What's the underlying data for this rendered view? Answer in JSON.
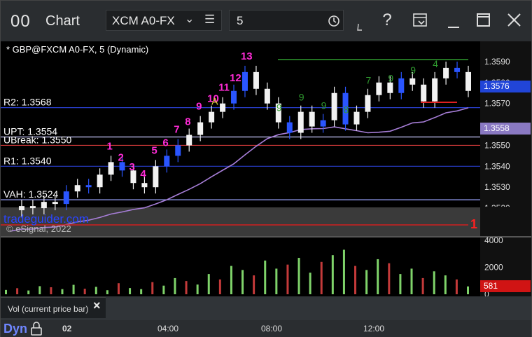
{
  "window": {
    "logo": "00",
    "title": "Chart",
    "symbol": "XCM A0-FX",
    "interval": "5",
    "menu_icon": "hamburger-icon",
    "help": "?"
  },
  "chart": {
    "title": "* GBP@FXCM A0-FX, 5 (Dynamic)",
    "copyright": "© eSignal, 2022",
    "watermark": "tradeguider.com",
    "price_axis": [
      "1.3590",
      "1.3580",
      "1.3570",
      "1.3550",
      "1.3540",
      "1.3530",
      "1.3520"
    ],
    "last_price": "1.3576",
    "ma_price": "1.3558",
    "red_marker": "1",
    "levels": [
      {
        "label": "R2: 1.3568",
        "price": 1.3568,
        "color": "#2a3fd0"
      },
      {
        "label": "UPT: 1.3554",
        "price": 1.3554,
        "color": "#c9c9ff"
      },
      {
        "label": "UBreak: 1.3550",
        "price": 1.355,
        "color": "#d23a3a"
      },
      {
        "label": "R1: 1.3540",
        "price": 1.354,
        "color": "#2a3fd0"
      },
      {
        "label": "VAH: 1.3524",
        "price": 1.3524,
        "color": "#9aa6ff"
      }
    ],
    "magenta_counts": [
      "13",
      "12",
      "11",
      "10",
      "9",
      "8",
      "7",
      "6",
      "5",
      "4",
      "3",
      "2",
      "1"
    ],
    "green_counts": [
      "9",
      "9",
      "9",
      "8",
      "7",
      "9",
      "9",
      "4"
    ],
    "marker_a": "A"
  },
  "volume": {
    "label": "Vol (current price bar)",
    "axis": [
      "4000",
      "2000",
      "0"
    ],
    "current": "581",
    "close_icon": "×"
  },
  "footer": {
    "mode": "Dyn",
    "times": [
      "02",
      "04:00",
      "08:00",
      "12:00"
    ]
  },
  "chart_data": {
    "type": "candlestick",
    "x": [
      "02",
      "04:00",
      "08:00",
      "12:00"
    ],
    "ylim": [
      1.3512,
      1.3597
    ],
    "price_series": [
      1.3519,
      1.3521,
      1.352,
      1.3523,
      1.3522,
      1.3528,
      1.3531,
      1.353,
      1.3536,
      1.3542,
      1.3538,
      1.3532,
      1.353,
      1.354,
      1.3545,
      1.355,
      1.3555,
      1.3561,
      1.3566,
      1.357,
      1.3576,
      1.3585,
      1.3577,
      1.357,
      1.3561,
      1.3556,
      1.3566,
      1.3559,
      1.3562,
      1.3575,
      1.356,
      1.3566,
      1.3574,
      1.358,
      1.3575,
      1.3582,
      1.3579,
      1.3571,
      1.3582,
      1.3587,
      1.3585,
      1.3576
    ],
    "volume_ylim": [
      0,
      4000
    ],
    "volume_series": [
      320,
      450,
      280,
      600,
      520,
      380,
      700,
      410,
      550,
      300,
      820,
      460,
      380,
      900,
      640,
      1200,
      980,
      720,
      1500,
      1100,
      2100,
      1800,
      1400,
      2500,
      1900,
      2200,
      2700,
      1600,
      2400,
      2900,
      3300,
      2100,
      1800,
      2600,
      2300,
      1500,
      1900,
      1200,
      1700,
      1400,
      1100,
      581
    ]
  }
}
